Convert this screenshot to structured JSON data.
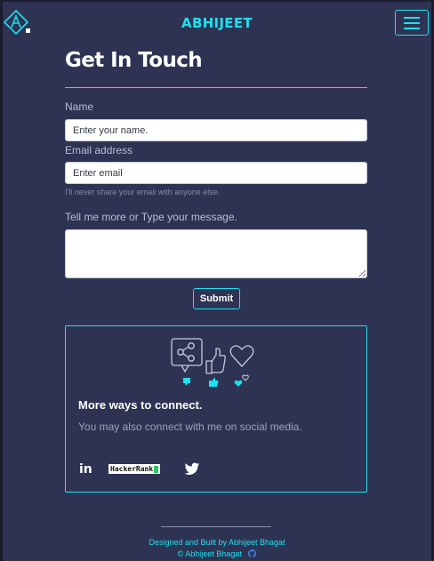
{
  "navbar": {
    "brand": "ABHIJEET",
    "logo_icon": "a-logo-icon",
    "menu_icon": "hamburger-menu-icon",
    "accent_color": "#1ee0ee"
  },
  "contact": {
    "title": "Get In Touch",
    "name_label": "Name",
    "name_placeholder": "Enter your name.",
    "email_label": "Email address",
    "email_placeholder": "Enter email",
    "email_hint": "I'll never share your email with anyone else.",
    "message_label": "Tell me more or Type your message.",
    "submit_label": "Submit"
  },
  "connect": {
    "illustration": "social-share-like-hearts-icon",
    "title": "More ways to connect.",
    "text": "You may also connect with me on social media.",
    "links": [
      {
        "name": "linkedin-icon",
        "label": "in"
      },
      {
        "name": "hackerrank-icon",
        "label": "HackerRank"
      },
      {
        "name": "twitter-icon"
      }
    ]
  },
  "footer": {
    "line1": "Designed and Built by Abhijeet Bhagat",
    "line2": "© Abhijeet Bhagat",
    "github_icon": "github-icon"
  },
  "colors": {
    "background": "#2e3353",
    "accent": "#1ee0ee",
    "text": "#ffffff",
    "muted": "#b9bed2"
  }
}
